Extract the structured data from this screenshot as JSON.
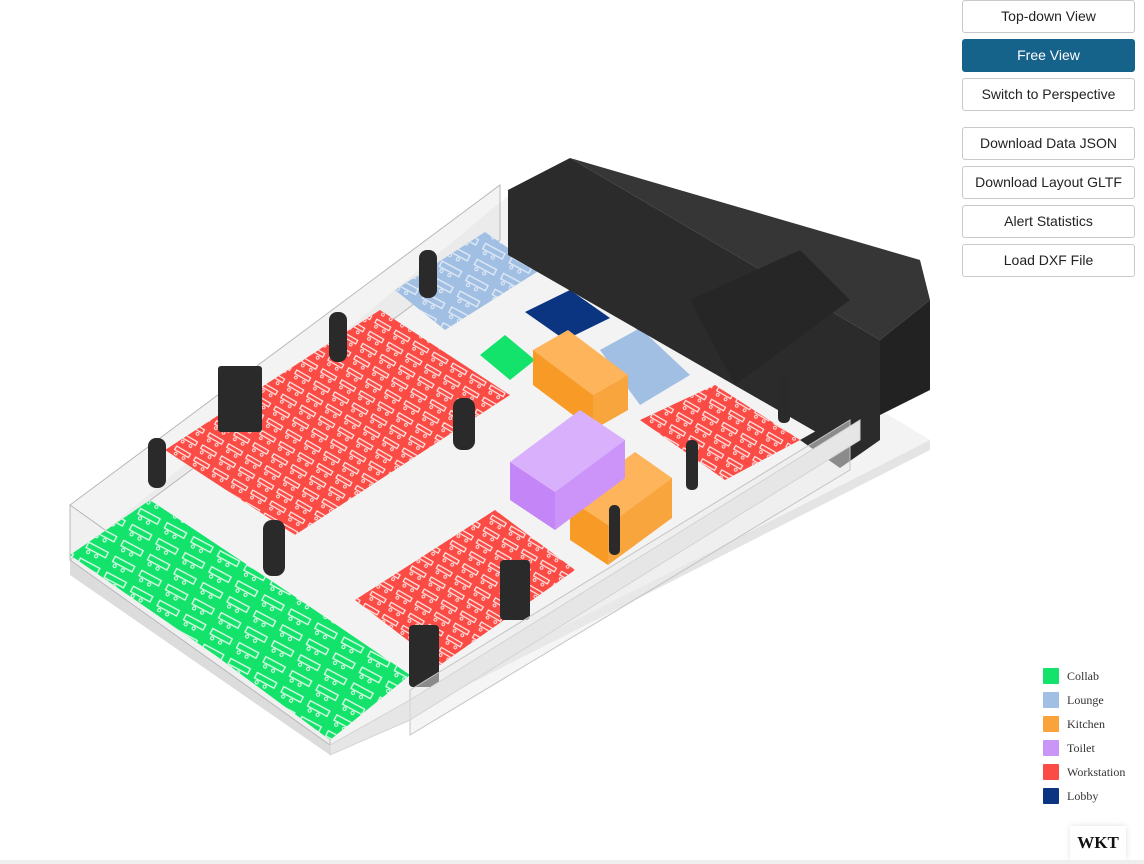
{
  "toolbar": {
    "top_down_view": "Top-down View",
    "free_view": "Free View",
    "switch_perspective": "Switch to Perspective",
    "download_json": "Download Data JSON",
    "download_gltf": "Download Layout GLTF",
    "alert_statistics": "Alert Statistics",
    "load_dxf": "Load DXF File",
    "active_button": "Free View",
    "active_color": "#15628a"
  },
  "legend": {
    "items": [
      {
        "label": "Collab",
        "color": "#13e36a"
      },
      {
        "label": "Lounge",
        "color": "#a1bfe3"
      },
      {
        "label": "Kitchen",
        "color": "#fba33b"
      },
      {
        "label": "Toilet",
        "color": "#c996f8"
      },
      {
        "label": "Workstation",
        "color": "#fb4b45"
      },
      {
        "label": "Lobby",
        "color": "#0b3580"
      }
    ]
  },
  "watermark": "WKT",
  "scene": {
    "core_color": "#2b2b2b",
    "column_icon": "cylinder-column",
    "floor_color": "#eeeeee"
  }
}
